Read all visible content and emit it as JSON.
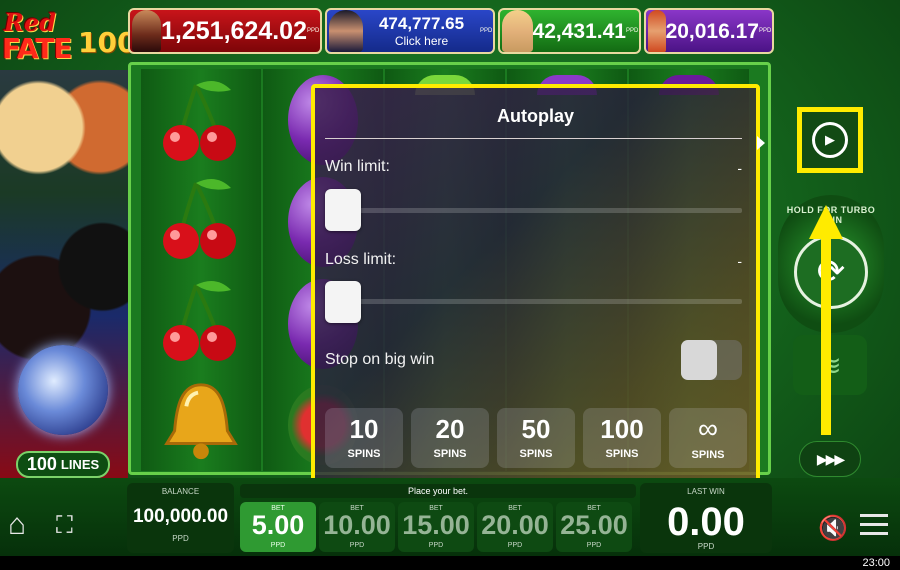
{
  "game": {
    "logo": {
      "line1": "Red",
      "line2": "FATE",
      "line3": "100"
    },
    "lines": {
      "count": "100",
      "label": "LINES"
    }
  },
  "jackpots": [
    {
      "amount": "1,251,624.02",
      "suffix": "PPD",
      "color": "#c8141a"
    },
    {
      "amount": "474,777.65",
      "action": "Click here",
      "suffix": "PPD",
      "color": "#2a46c8"
    },
    {
      "amount": "42,431.41",
      "suffix": "PPD",
      "color": "#2fb32f"
    },
    {
      "amount": "20,016.17",
      "suffix": "PPD",
      "color": "#8a36c8"
    }
  ],
  "reels": [
    [
      "cherry",
      "cherry",
      "cherry",
      "bell"
    ],
    [
      "plum",
      "plum",
      "plum",
      "melon"
    ],
    [
      "lime"
    ],
    [
      "plum"
    ],
    [
      "grapes"
    ]
  ],
  "autoplay": {
    "title": "Autoplay",
    "win_limit": {
      "label": "Win limit:",
      "value": "-",
      "slider": 0
    },
    "loss_limit": {
      "label": "Loss limit:",
      "value": "-",
      "slider": 0
    },
    "stop_on_big_win": {
      "label": "Stop on big win",
      "enabled": false
    },
    "spin_options": [
      {
        "value": "10",
        "unit": "SPINS"
      },
      {
        "value": "20",
        "unit": "SPINS"
      },
      {
        "value": "50",
        "unit": "SPINS"
      },
      {
        "value": "100",
        "unit": "SPINS"
      },
      {
        "value": "∞",
        "unit": "SPINS"
      }
    ],
    "highlight_color": "#ffeb00"
  },
  "controls": {
    "turbo_hint": "HOLD FOR TURBO SPIN",
    "autoplay_icon": "autoplay-icon",
    "spin_icon": "spin-icon",
    "coins_icon": "coin-stack-icon",
    "turbo_icon": "fast-forward-icon"
  },
  "bottom_bar": {
    "balance": {
      "label": "BALANCE",
      "value": "100,000.00",
      "currency": "PPD"
    },
    "place_bet": "Place your bet.",
    "bets": [
      {
        "label": "BET",
        "value": "5.00",
        "currency": "PPD",
        "selected": true
      },
      {
        "label": "BET",
        "value": "10.00",
        "currency": "PPD",
        "selected": false
      },
      {
        "label": "BET",
        "value": "15.00",
        "currency": "PPD",
        "selected": false
      },
      {
        "label": "BET",
        "value": "20.00",
        "currency": "PPD",
        "selected": false
      },
      {
        "label": "BET",
        "value": "25.00",
        "currency": "PPD",
        "selected": false
      }
    ],
    "last_win": {
      "label": "LAST WIN",
      "value": "0.00",
      "currency": "PPD"
    },
    "icons": [
      "home-icon",
      "fullscreen-icon",
      "mute-icon",
      "menu-icon"
    ]
  },
  "status_bar": {
    "time": "23:00"
  }
}
